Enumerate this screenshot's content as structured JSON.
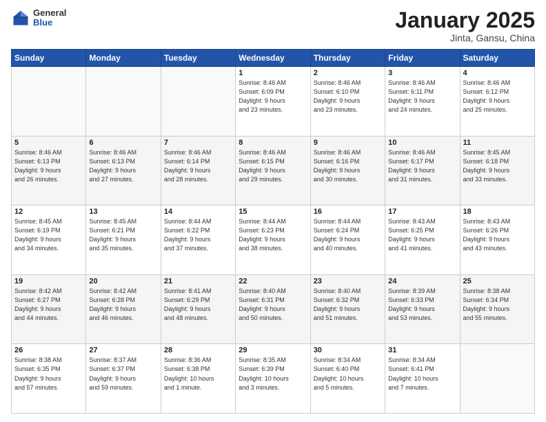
{
  "header": {
    "logo_general": "General",
    "logo_blue": "Blue",
    "month_title": "January 2025",
    "subtitle": "Jinta, Gansu, China"
  },
  "weekdays": [
    "Sunday",
    "Monday",
    "Tuesday",
    "Wednesday",
    "Thursday",
    "Friday",
    "Saturday"
  ],
  "weeks": [
    [
      {
        "day": "",
        "info": ""
      },
      {
        "day": "",
        "info": ""
      },
      {
        "day": "",
        "info": ""
      },
      {
        "day": "1",
        "info": "Sunrise: 8:46 AM\nSunset: 6:09 PM\nDaylight: 9 hours\nand 23 minutes."
      },
      {
        "day": "2",
        "info": "Sunrise: 8:46 AM\nSunset: 6:10 PM\nDaylight: 9 hours\nand 23 minutes."
      },
      {
        "day": "3",
        "info": "Sunrise: 8:46 AM\nSunset: 6:11 PM\nDaylight: 9 hours\nand 24 minutes."
      },
      {
        "day": "4",
        "info": "Sunrise: 8:46 AM\nSunset: 6:12 PM\nDaylight: 9 hours\nand 25 minutes."
      }
    ],
    [
      {
        "day": "5",
        "info": "Sunrise: 8:46 AM\nSunset: 6:13 PM\nDaylight: 9 hours\nand 26 minutes."
      },
      {
        "day": "6",
        "info": "Sunrise: 8:46 AM\nSunset: 6:13 PM\nDaylight: 9 hours\nand 27 minutes."
      },
      {
        "day": "7",
        "info": "Sunrise: 8:46 AM\nSunset: 6:14 PM\nDaylight: 9 hours\nand 28 minutes."
      },
      {
        "day": "8",
        "info": "Sunrise: 8:46 AM\nSunset: 6:15 PM\nDaylight: 9 hours\nand 29 minutes."
      },
      {
        "day": "9",
        "info": "Sunrise: 8:46 AM\nSunset: 6:16 PM\nDaylight: 9 hours\nand 30 minutes."
      },
      {
        "day": "10",
        "info": "Sunrise: 8:46 AM\nSunset: 6:17 PM\nDaylight: 9 hours\nand 31 minutes."
      },
      {
        "day": "11",
        "info": "Sunrise: 8:45 AM\nSunset: 6:18 PM\nDaylight: 9 hours\nand 33 minutes."
      }
    ],
    [
      {
        "day": "12",
        "info": "Sunrise: 8:45 AM\nSunset: 6:19 PM\nDaylight: 9 hours\nand 34 minutes."
      },
      {
        "day": "13",
        "info": "Sunrise: 8:45 AM\nSunset: 6:21 PM\nDaylight: 9 hours\nand 35 minutes."
      },
      {
        "day": "14",
        "info": "Sunrise: 8:44 AM\nSunset: 6:22 PM\nDaylight: 9 hours\nand 37 minutes."
      },
      {
        "day": "15",
        "info": "Sunrise: 8:44 AM\nSunset: 6:23 PM\nDaylight: 9 hours\nand 38 minutes."
      },
      {
        "day": "16",
        "info": "Sunrise: 8:44 AM\nSunset: 6:24 PM\nDaylight: 9 hours\nand 40 minutes."
      },
      {
        "day": "17",
        "info": "Sunrise: 8:43 AM\nSunset: 6:25 PM\nDaylight: 9 hours\nand 41 minutes."
      },
      {
        "day": "18",
        "info": "Sunrise: 8:43 AM\nSunset: 6:26 PM\nDaylight: 9 hours\nand 43 minutes."
      }
    ],
    [
      {
        "day": "19",
        "info": "Sunrise: 8:42 AM\nSunset: 6:27 PM\nDaylight: 9 hours\nand 44 minutes."
      },
      {
        "day": "20",
        "info": "Sunrise: 8:42 AM\nSunset: 6:28 PM\nDaylight: 9 hours\nand 46 minutes."
      },
      {
        "day": "21",
        "info": "Sunrise: 8:41 AM\nSunset: 6:29 PM\nDaylight: 9 hours\nand 48 minutes."
      },
      {
        "day": "22",
        "info": "Sunrise: 8:40 AM\nSunset: 6:31 PM\nDaylight: 9 hours\nand 50 minutes."
      },
      {
        "day": "23",
        "info": "Sunrise: 8:40 AM\nSunset: 6:32 PM\nDaylight: 9 hours\nand 51 minutes."
      },
      {
        "day": "24",
        "info": "Sunrise: 8:39 AM\nSunset: 6:33 PM\nDaylight: 9 hours\nand 53 minutes."
      },
      {
        "day": "25",
        "info": "Sunrise: 8:38 AM\nSunset: 6:34 PM\nDaylight: 9 hours\nand 55 minutes."
      }
    ],
    [
      {
        "day": "26",
        "info": "Sunrise: 8:38 AM\nSunset: 6:35 PM\nDaylight: 9 hours\nand 57 minutes."
      },
      {
        "day": "27",
        "info": "Sunrise: 8:37 AM\nSunset: 6:37 PM\nDaylight: 9 hours\nand 59 minutes."
      },
      {
        "day": "28",
        "info": "Sunrise: 8:36 AM\nSunset: 6:38 PM\nDaylight: 10 hours\nand 1 minute."
      },
      {
        "day": "29",
        "info": "Sunrise: 8:35 AM\nSunset: 6:39 PM\nDaylight: 10 hours\nand 3 minutes."
      },
      {
        "day": "30",
        "info": "Sunrise: 8:34 AM\nSunset: 6:40 PM\nDaylight: 10 hours\nand 5 minutes."
      },
      {
        "day": "31",
        "info": "Sunrise: 8:34 AM\nSunset: 6:41 PM\nDaylight: 10 hours\nand 7 minutes."
      },
      {
        "day": "",
        "info": ""
      }
    ]
  ]
}
